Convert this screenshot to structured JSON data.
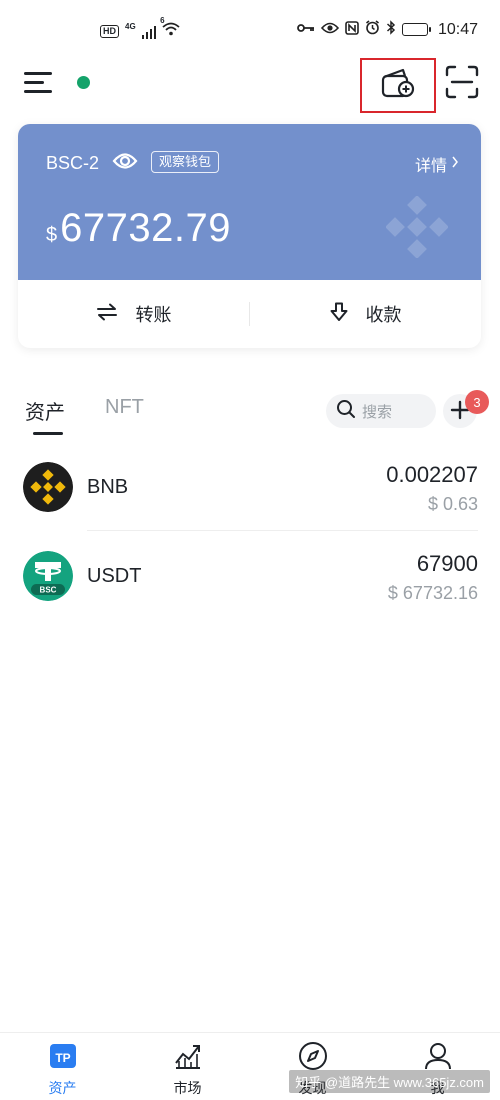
{
  "status_bar": {
    "hd": "HD",
    "network": "4G",
    "wifi_sup": "6",
    "time": "10:47"
  },
  "header": {
    "menu_icon": "menu-icon",
    "online_color": "#14a36a",
    "add_wallet_icon": "wallet-plus-icon",
    "scan_icon": "scan-icon"
  },
  "wallet": {
    "name": "BSC-2",
    "watch_label": "观察钱包",
    "detail_label": "详情",
    "currency_symbol": "$",
    "balance": "67732.79",
    "card_color": "#7390cc",
    "actions": {
      "transfer_label": "转账",
      "receive_label": "收款"
    }
  },
  "assets": {
    "tabs": [
      {
        "label": "资产",
        "active": true
      },
      {
        "label": "NFT",
        "active": false
      }
    ],
    "search_placeholder": "搜索",
    "add_badge_count": "3",
    "tokens": [
      {
        "symbol": "BNB",
        "balance": "0.002207",
        "value": "$ 0.63"
      },
      {
        "symbol": "USDT",
        "balance": "67900",
        "value": "$ 67732.16"
      }
    ]
  },
  "bottom_nav": {
    "items": [
      {
        "label": "资产",
        "icon": "tp-wallet-icon",
        "active": true
      },
      {
        "label": "市场",
        "icon": "market-chart-icon",
        "active": false
      },
      {
        "label": "发现",
        "icon": "compass-icon",
        "active": false
      },
      {
        "label": "我",
        "icon": "user-icon",
        "active": false
      }
    ],
    "accent": "#2a7df1"
  },
  "watermark": "知乎 @道路先生 www.365jz.com"
}
